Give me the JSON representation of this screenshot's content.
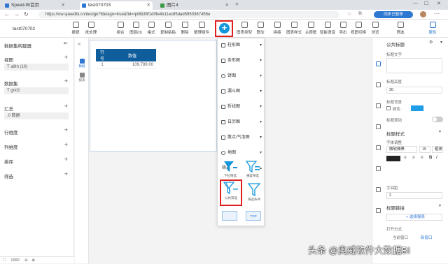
{
  "browser": {
    "tabs": [
      {
        "label": "Speed-BI首页",
        "color": "#2f78d2"
      },
      {
        "label": "test070703",
        "color": "#2f78d2"
      },
      {
        "label": "图片4",
        "color": "#3c9b46"
      }
    ],
    "url": "https://ow.speedbi.cn/design?fdesign=true&fid=rpt8b38f1d0fe4b11ec85dad5950367455e",
    "sync_label": "同步已暂停"
  },
  "toolbar": {
    "file_name": "test070702",
    "items": [
      "撤销",
      "批处理",
      "组合",
      "图层(0)",
      "格式",
      "复制粘贴",
      "删除",
      "整理组件",
      "新增",
      "图表类型",
      "联动",
      "拼接",
      "图表样式",
      "主题框",
      "智能语音",
      "导出",
      "视图切换",
      "浏览",
      "筛选",
      "属性"
    ]
  },
  "left_panel": {
    "title": "数据集构建器",
    "sections": [
      {
        "label": "视图",
        "box": "T  a8th (10)"
      },
      {
        "label": "数据集",
        "box": "T  grid1"
      },
      {
        "label": "汇总",
        "box": ".0  数据"
      },
      {
        "label": "行维度",
        "box": ""
      },
      {
        "label": "列维度",
        "box": ""
      },
      {
        "label": "排序",
        "box": ""
      },
      {
        "label": "筛选",
        "box": ""
      }
    ],
    "zoom": "1000"
  },
  "rail": {
    "items": [
      "数据",
      "报表"
    ]
  },
  "canvas": {
    "headers": [
      "行号",
      "数值"
    ],
    "rows": [
      [
        "1",
        "109,789.00"
      ]
    ]
  },
  "menu": {
    "items": [
      "柱形图",
      "条形图",
      "饼图",
      "漏斗图",
      "折线图",
      "日历图",
      "散点/气泡图",
      "地图",
      "筛选"
    ],
    "filters": [
      "下拉筛选",
      "横复筛选",
      "公共筛选",
      "筛选条件"
    ],
    "toggles": [
      "",
      "TOP"
    ]
  },
  "props": {
    "header": "公共标题",
    "title_text_label": "标题文字",
    "title_height_label": "标题高度",
    "title_height_value": "30",
    "title_bg_label": "标题背景",
    "transparent_label": "颜色",
    "title_scroll_label": "标题滚动",
    "style_header": "标题样式",
    "font_label": "字体调整",
    "font_name": "微软雅黑",
    "font_size": "15",
    "font_weight": "粗体",
    "spacing_label": "字间距",
    "spacing_value": "2",
    "link_header": "标题链接",
    "choose_report": "+ 选择报表",
    "open_mode_label": "打开方式",
    "open_current": "当前窗口",
    "open_new": "新窗口",
    "bg_color": "#1e9de8"
  },
  "watermark": "头条 @奥威软件大数据BI"
}
